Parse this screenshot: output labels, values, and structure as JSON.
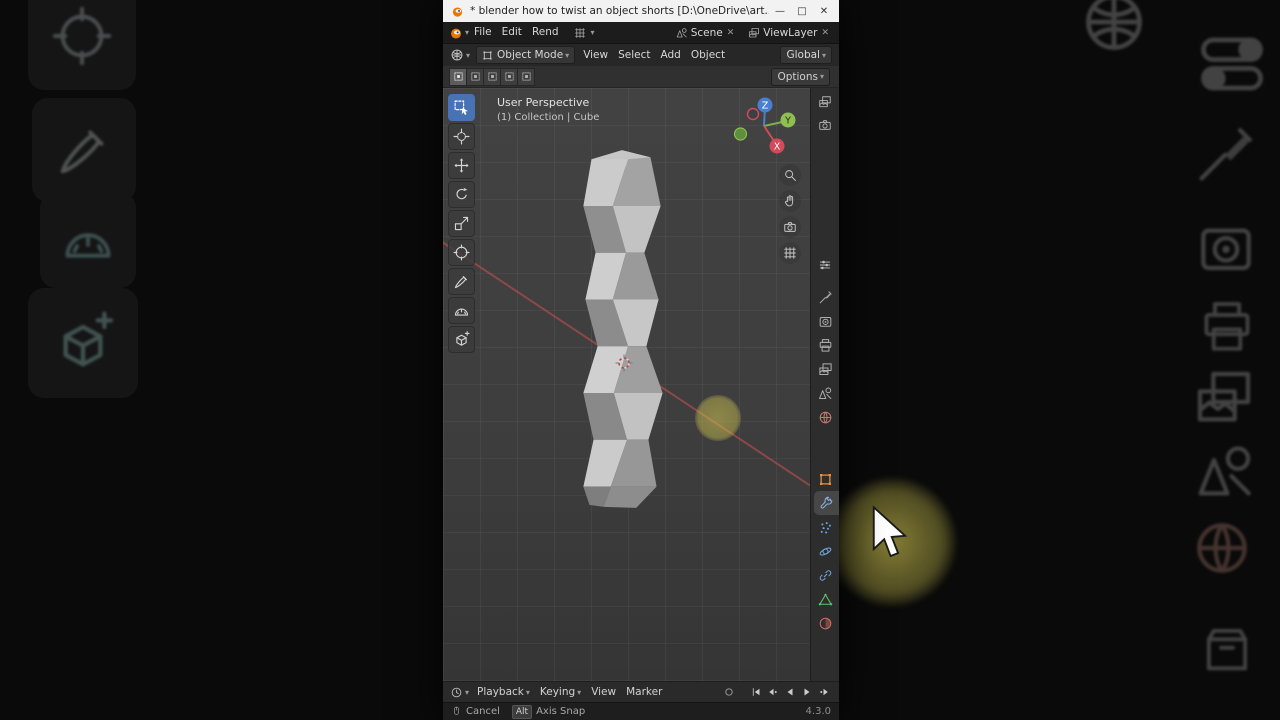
{
  "window": {
    "title": "* blender how to twist an object shorts [D:\\OneDrive\\art...",
    "minimize": "—",
    "maximize": "□",
    "close": "✕"
  },
  "topbar": {
    "menus": [
      "File",
      "Edit",
      "Rend"
    ],
    "scene_label": "Scene",
    "view_layer_label": "ViewLayer"
  },
  "header": {
    "mode": "Object Mode",
    "menus": [
      "View",
      "Select",
      "Add",
      "Object"
    ],
    "orientation": "Global",
    "options": "Options"
  },
  "tool_settings": {
    "select_modes": [
      "new",
      "extend",
      "subtract",
      "invert",
      "intersect"
    ]
  },
  "viewport": {
    "overlay_title": "User Perspective",
    "overlay_subtitle": "(1) Collection | Cube",
    "gizmo": {
      "x": "X",
      "y": "Y",
      "z": "Z"
    },
    "tools": [
      {
        "name": "select-box",
        "icon": "select",
        "active": true
      },
      {
        "name": "cursor",
        "icon": "cursor3d"
      },
      {
        "name": "move",
        "icon": "move"
      },
      {
        "name": "rotate",
        "icon": "rotate"
      },
      {
        "name": "scale",
        "icon": "scale"
      },
      {
        "name": "transform",
        "icon": "transform"
      },
      {
        "name": "annotate",
        "icon": "annotate"
      },
      {
        "name": "measure",
        "icon": "measure"
      },
      {
        "name": "add-cube",
        "icon": "addcube"
      }
    ],
    "nav": [
      {
        "name": "zoom",
        "icon": "zoom"
      },
      {
        "name": "pan",
        "icon": "hand"
      },
      {
        "name": "camera-view",
        "icon": "camera"
      },
      {
        "name": "toggle-perspective",
        "icon": "gridpersp"
      }
    ]
  },
  "properties": {
    "top_icons": [
      {
        "name": "image",
        "icon": "images"
      },
      {
        "name": "camera",
        "icon": "camera"
      }
    ],
    "tabs": [
      {
        "name": "tool",
        "icon": "toolwrench",
        "color": "#aeaeae"
      },
      {
        "name": "render",
        "icon": "render",
        "color": "#aeaeae"
      },
      {
        "name": "output",
        "icon": "printer",
        "color": "#aeaeae"
      },
      {
        "name": "view-layer",
        "icon": "images",
        "color": "#aeaeae"
      },
      {
        "name": "scene",
        "icon": "scene",
        "color": "#aeaeae"
      },
      {
        "name": "world",
        "icon": "world",
        "color": "#c27a6e"
      },
      {
        "gap": true
      },
      {
        "name": "object",
        "icon": "objsquare",
        "color": "#ef9038"
      },
      {
        "name": "modifiers",
        "icon": "wrench",
        "color": "#8ab4e8",
        "active": true
      },
      {
        "name": "particles",
        "icon": "particles",
        "color": "#74a8e0"
      },
      {
        "name": "physics",
        "icon": "physics",
        "color": "#74a8e0"
      },
      {
        "name": "constraints",
        "icon": "constraints",
        "color": "#74a8e0"
      },
      {
        "name": "data",
        "icon": "datatri",
        "color": "#5ec46a"
      },
      {
        "name": "material",
        "icon": "material",
        "color": "#d46a62"
      }
    ]
  },
  "timeline": {
    "menus": [
      {
        "label": "Playback",
        "caret": true
      },
      {
        "label": "Keying",
        "caret": true
      },
      {
        "label": "View"
      },
      {
        "label": "Marker"
      }
    ],
    "playback": [
      {
        "name": "jump-to-start",
        "icon": "jumpstart"
      },
      {
        "name": "previous-keyframe",
        "icon": "prevkey"
      },
      {
        "name": "play-reverse",
        "icon": "playrev"
      },
      {
        "name": "play",
        "icon": "play"
      },
      {
        "name": "next-keyframe",
        "icon": "nextkey"
      }
    ]
  },
  "statusbar": {
    "cancel": "Cancel",
    "key": "Alt",
    "action": "Axis Snap",
    "version": "4.3.0"
  },
  "colors": {
    "accent": "#4772b3",
    "axis_x": "#cc4d57",
    "axis_y": "#7fae4e",
    "axis_z": "#4a7fd0",
    "object_orange": "#e87d0d"
  }
}
